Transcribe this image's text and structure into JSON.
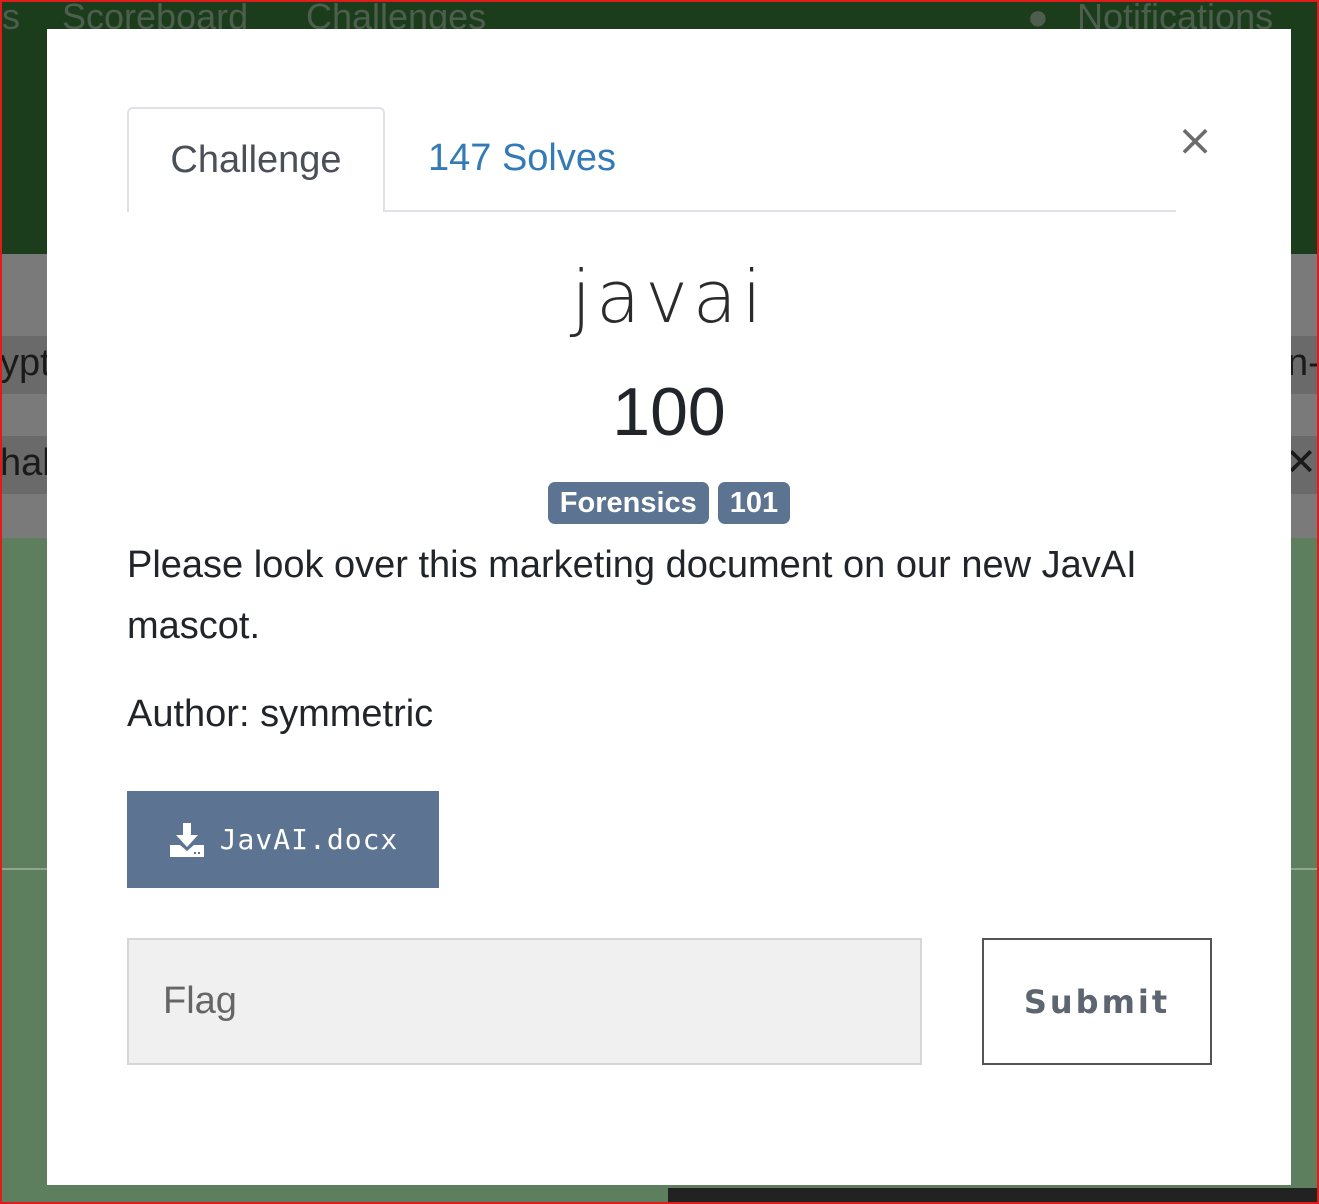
{
  "background": {
    "nav_items": [
      "s",
      "Scoreboard",
      "Challenges",
      "Notifications"
    ],
    "band1_left": "ypt",
    "band1_right": "n-S",
    "band2_left": "hal",
    "band2_right": "✕"
  },
  "tabs": {
    "challenge": "Challenge",
    "solves": "147 Solves"
  },
  "close_symbol": "×",
  "challenge": {
    "name": "javai",
    "points": "100",
    "tags": [
      "Forensics",
      "101"
    ],
    "description": "Please look over this marketing document on our new JavAI mascot.",
    "author": "Author: symmetric",
    "file": "JavAI.docx"
  },
  "form": {
    "flag_placeholder": "Flag",
    "submit_label": "Submit"
  },
  "colors": {
    "tag": "#5c7391",
    "link": "#337ab7",
    "border": "#e01b1b"
  }
}
